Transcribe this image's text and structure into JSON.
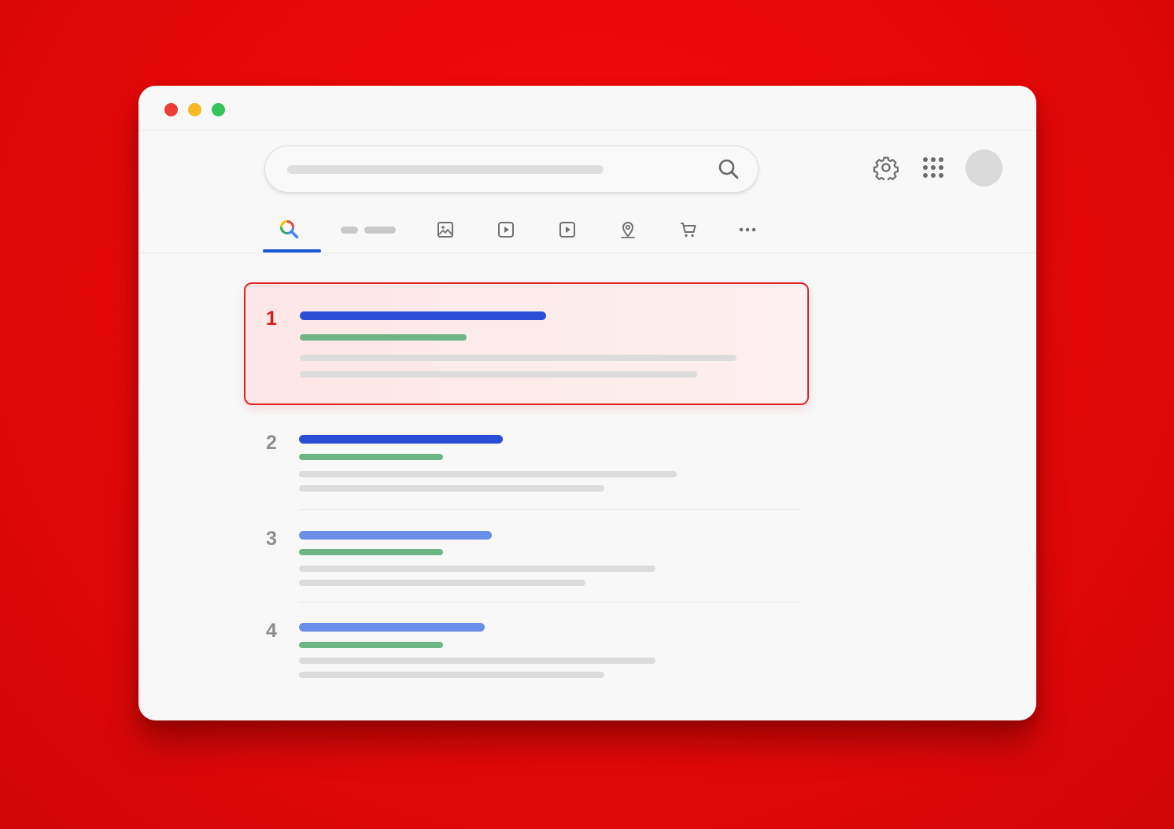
{
  "window": {
    "traffic_lights": [
      {
        "name": "close",
        "color": "#ee3b36"
      },
      {
        "name": "minimize",
        "color": "#f7b928"
      },
      {
        "name": "zoom",
        "color": "#38c35a"
      }
    ]
  },
  "search": {
    "icon": "search-icon"
  },
  "header_icons": [
    "gear-icon",
    "apps-grid-icon"
  ],
  "tabs": [
    {
      "icon": "google-search-icon",
      "active": true
    },
    {
      "icon": "text-tab-placeholder"
    },
    {
      "icon": "image-icon"
    },
    {
      "icon": "video-play-icon"
    },
    {
      "icon": "video-play-icon"
    },
    {
      "icon": "map-pin-icon"
    },
    {
      "icon": "shopping-cart-icon"
    },
    {
      "icon": "more-dots-icon"
    }
  ],
  "colors": {
    "background": "#e80909",
    "accent_blue": "#1a56d8",
    "title_blue_strong": "#2a4fd6",
    "title_blue_light": "#6b8ee6",
    "url_green": "#6db585",
    "highlight_border": "#e02424"
  },
  "results": [
    {
      "rank": "1",
      "highlighted": true
    },
    {
      "rank": "2",
      "highlighted": false
    },
    {
      "rank": "3",
      "highlighted": false
    },
    {
      "rank": "4",
      "highlighted": false
    }
  ]
}
